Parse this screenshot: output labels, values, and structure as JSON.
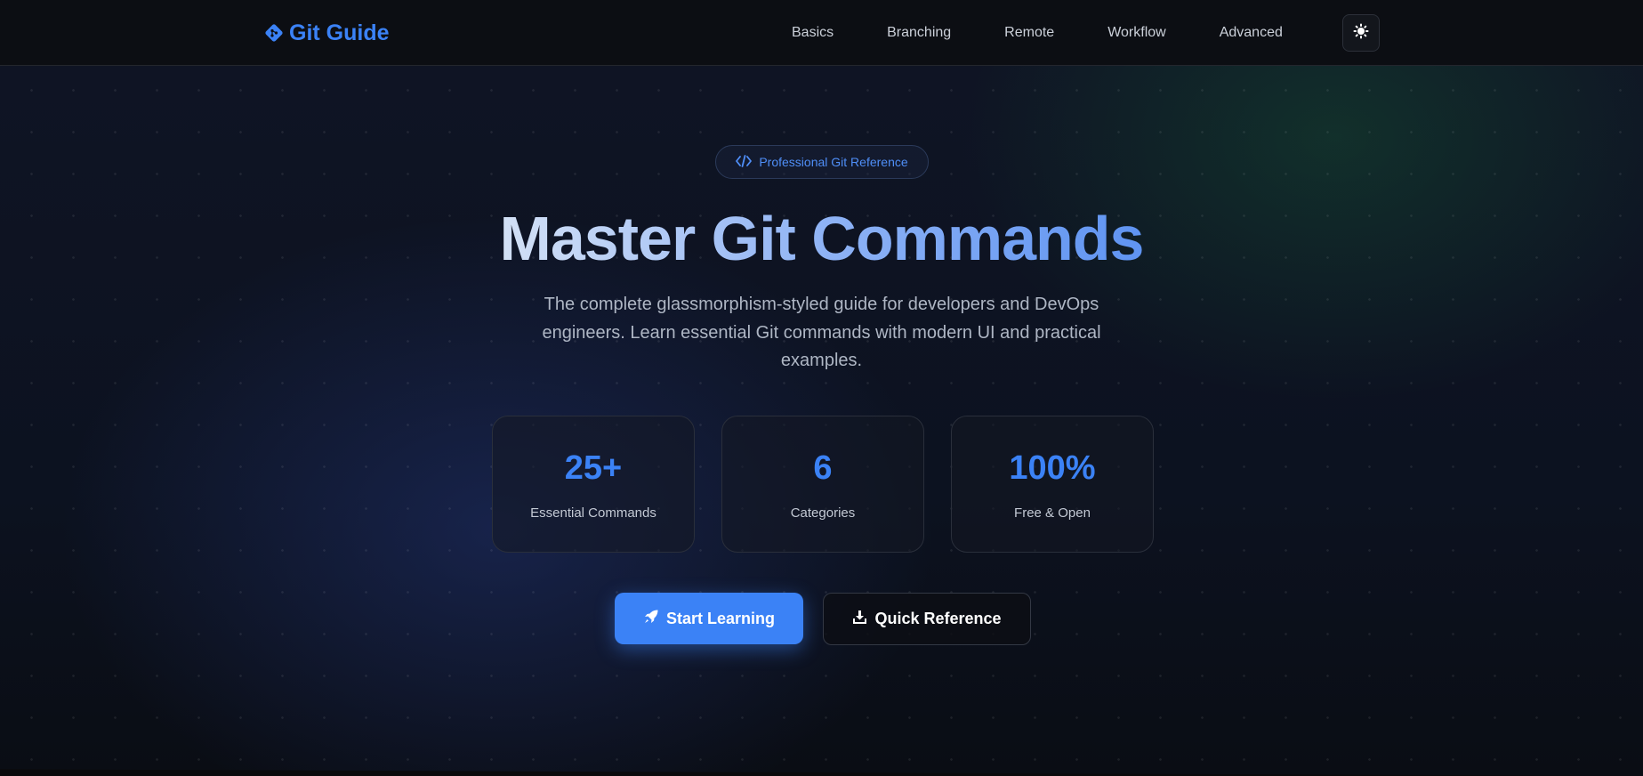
{
  "brand": {
    "name": "Git Guide",
    "icon": "git-diamond-icon",
    "color": "#3b82f6"
  },
  "nav": {
    "items": [
      {
        "label": "Basics"
      },
      {
        "label": "Branching"
      },
      {
        "label": "Remote"
      },
      {
        "label": "Workflow"
      },
      {
        "label": "Advanced"
      }
    ],
    "theme_toggle_icon": "sun-icon"
  },
  "hero": {
    "badge": {
      "icon": "code-icon",
      "label": "Professional Git Reference"
    },
    "title": "Master Git Commands",
    "subtitle": "The complete glassmorphism-styled guide for developers and DevOps engineers. Learn essential Git commands with modern UI and practical examples.",
    "stats": [
      {
        "value": "25+",
        "label": "Essential Commands"
      },
      {
        "value": "6",
        "label": "Categories"
      },
      {
        "value": "100%",
        "label": "Free & Open"
      }
    ],
    "primary_button": {
      "icon": "rocket-icon",
      "label": "Start Learning"
    },
    "secondary_button": {
      "icon": "download-icon",
      "label": "Quick Reference"
    }
  },
  "colors": {
    "accent": "#3b82f6",
    "background": "#0b0d12",
    "text_muted": "#aeb6c4"
  }
}
